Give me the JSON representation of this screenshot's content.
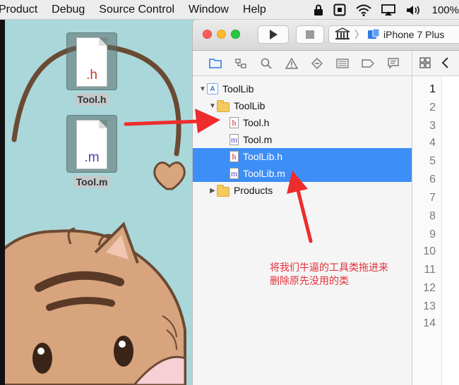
{
  "menubar": {
    "items": [
      "Product",
      "Debug",
      "Source Control",
      "Window",
      "Help"
    ],
    "battery": "100%"
  },
  "desktop": {
    "files": [
      {
        "ext": ".h",
        "name": "Tool.h",
        "ext_color": "#c0392b"
      },
      {
        "ext": ".m",
        "name": "Tool.m",
        "ext_color": "#4b3fb3"
      }
    ]
  },
  "toolbar": {
    "scheme_device": "iPhone 7 Plus"
  },
  "navigator": {
    "items": [
      {
        "label": "ToolLib",
        "level": 0,
        "kind": "project",
        "disclosure": "open",
        "selected": false
      },
      {
        "label": "ToolLib",
        "level": 1,
        "kind": "folder",
        "disclosure": "open",
        "selected": false
      },
      {
        "label": "Tool.h",
        "level": 2,
        "kind": "h",
        "disclosure": "",
        "selected": false
      },
      {
        "label": "Tool.m",
        "level": 2,
        "kind": "m",
        "disclosure": "",
        "selected": false
      },
      {
        "label": "ToolLib.h",
        "level": 2,
        "kind": "h",
        "disclosure": "",
        "selected": true
      },
      {
        "label": "ToolLib.m",
        "level": 2,
        "kind": "m",
        "disclosure": "",
        "selected": true
      },
      {
        "label": "Products",
        "level": 1,
        "kind": "folder",
        "disclosure": "closed",
        "selected": false
      }
    ]
  },
  "editor": {
    "line_numbers": [
      "1",
      "2",
      "3",
      "4",
      "5",
      "6",
      "7",
      "8",
      "9",
      "10",
      "11",
      "12",
      "13",
      "14"
    ],
    "current_line": "1"
  },
  "annotation": {
    "line1": "将我们牛逼的工具类拖进来",
    "line2": "删除原先没用的类"
  },
  "colors": {
    "selection": "#3d8ef6",
    "annotation": "#e5303b",
    "arrow": "#ee2c2c"
  }
}
